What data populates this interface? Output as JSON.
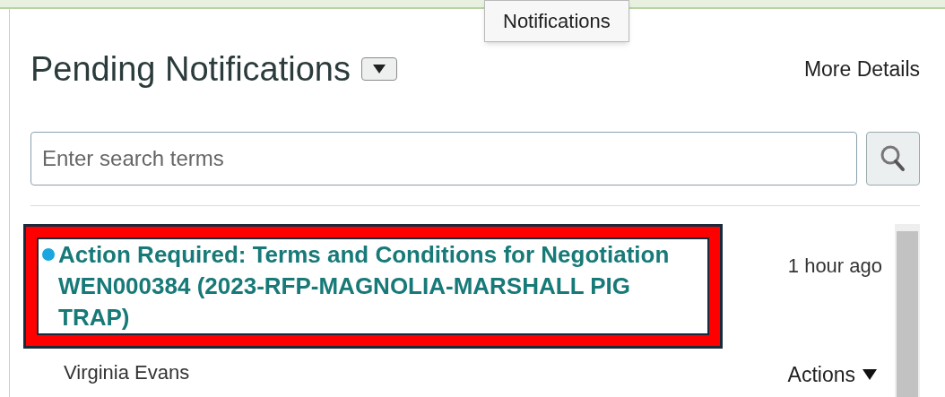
{
  "tooltip": {
    "text": "Notifications"
  },
  "header": {
    "title": "Pending Notifications",
    "link": "More Details"
  },
  "search": {
    "placeholder": "Enter search terms"
  },
  "notifications": [
    {
      "title": "Action Required: Terms and Conditions for Negotiation WEN000384 (2023-RFP-MAGNOLIA-MARSHALL PIG TRAP)",
      "unread": true,
      "highlighted": true,
      "time": "1 hour ago",
      "sender": "Virginia Evans",
      "actions": "Actions"
    }
  ]
}
